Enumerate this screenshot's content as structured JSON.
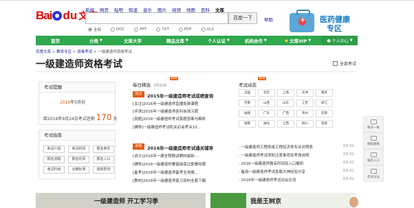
{
  "header": {
    "logo_bai": "Bai",
    "logo_du": "du",
    "logo_wenku": "文库",
    "nav": [
      "新闻",
      "网页",
      "贴吧",
      "知道",
      "音乐",
      "图片",
      "视频",
      "地图",
      "百科",
      "文库"
    ],
    "search_button": "百度一下",
    "help": "帮助",
    "filters": [
      "全部",
      "DOC",
      "PPT",
      "TXT",
      "PDF",
      "XLS"
    ],
    "ad_title_1": "医药健康",
    "ad_title_2": "专区"
  },
  "navbar": {
    "items": [
      "首页",
      "分类",
      "文库大学",
      "精品文库",
      "个人认证",
      "机构合作"
    ],
    "vip": "文库VIP",
    "user_center": "个人中心"
  },
  "breadcrumb": {
    "items": [
      "百度文库",
      "教育专区",
      "资格考试"
    ],
    "current": "一级建造师资格考试"
  },
  "page": {
    "title": "一级建造师资格考试",
    "all_topics": "全部考试"
  },
  "reminder": {
    "title": "考试提醒",
    "year": "2016",
    "exam_month": "年5月份",
    "line2_prefix": "距2016年9月24日考试还剩",
    "days": "170",
    "days_unit": "天"
  },
  "guide": {
    "title": "考试指南",
    "tags": [
      [
        "考试介绍",
        "考试时间",
        "报名条件"
      ],
      [
        "报名流程",
        "报名时间",
        "报名入口"
      ],
      [
        "考试科目",
        "合格标准",
        "成绩查询"
      ]
    ]
  },
  "picks": {
    "title": "每日精选",
    "date": "3月31日",
    "new_badge": "NEW",
    "hot": "热点",
    "headline1": "2015年一级建造师考试成绩查询",
    "lines1": [
      "[关注]2016年一级建造师直播免费课程",
      "[评测]2016年一级建造师各科自测习题",
      "[真题]2016一级建造师考试真题答案与解析",
      "[辅导]一级建造师考试机关必会考点10..."
    ],
    "hot2": "资格",
    "headline2": "2016年一级建造师考试通关辅导",
    "lines2": [
      "[讲义]2016年一建全程精讲教材最新...",
      "[辅导]2016一级建造师要基础保过套餐特惠",
      "[备考]2016年一级建造师备考全攻略...",
      "[教材]2016年一级建造师复习资料全套下载"
    ]
  },
  "news": {
    "title": "考试动态",
    "new_badge": "NEW",
    "regions": [
      "全国",
      "北京",
      "上海",
      "天津",
      "重庆",
      "河南",
      "山西",
      "山东",
      "江苏",
      "浙江",
      "福建",
      "广东",
      "广西",
      "贵州",
      "云南",
      "湖南",
      "湖北",
      "江西",
      "四川",
      "其他"
    ],
    "items": [
      {
        "text": "一级建造师工程类或工程经济类专业对照表",
        "date": "03-31"
      },
      {
        "text": "一级建造师考试须知注意事项及考场说明",
        "date": "03-31"
      },
      {
        "text": "2016一级建造师报名时间及入口解析",
        "date": "03-31"
      },
      {
        "text": "备战一级建造师考试各路大神经验分享",
        "date": "03-31"
      },
      {
        "text": "2016年一级建造师考试论坛交流",
        "date": "03-31"
      }
    ]
  },
  "side_tools": [
    "每日一练",
    "模拟题库",
    "报名入口",
    "考试论坛"
  ],
  "bottom": {
    "banner1": "一级建造师 开工学习季",
    "banner2": "我是王树京"
  }
}
